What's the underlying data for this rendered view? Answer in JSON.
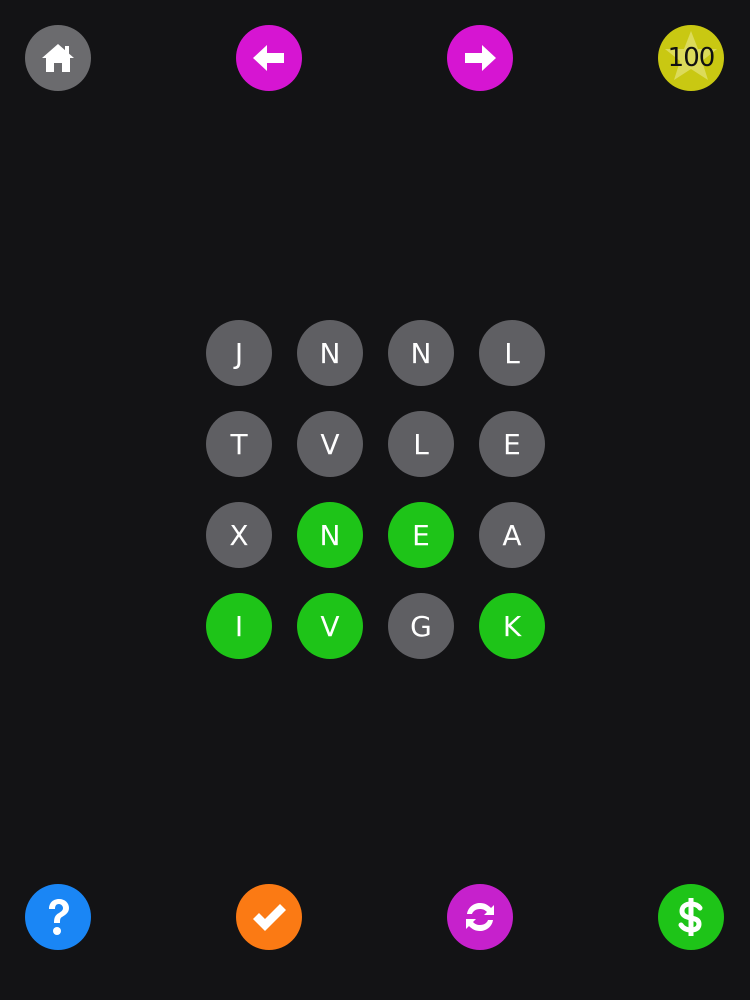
{
  "colors": {
    "background": "#131315",
    "tile_default": "#5f5f63",
    "tile_selected": "#1ec418",
    "home": "#6b6b6e",
    "nav_arrows": "#d615d2",
    "coins": "#c9c812",
    "help": "#1a86f5",
    "check": "#fb7a14",
    "shuffle": "#c621cc",
    "buy": "#1ec418"
  },
  "header": {
    "home_icon": "house-icon",
    "back_icon": "arrow-left-icon",
    "forward_icon": "arrow-right-icon",
    "coins_icon": "star-icon",
    "coins": "100"
  },
  "board": {
    "rows": [
      [
        {
          "letter": "J",
          "selected": false
        },
        {
          "letter": "N",
          "selected": false
        },
        {
          "letter": "N",
          "selected": false
        },
        {
          "letter": "L",
          "selected": false
        }
      ],
      [
        {
          "letter": "T",
          "selected": false
        },
        {
          "letter": "V",
          "selected": false
        },
        {
          "letter": "L",
          "selected": false
        },
        {
          "letter": "E",
          "selected": false
        }
      ],
      [
        {
          "letter": "X",
          "selected": false
        },
        {
          "letter": "N",
          "selected": true
        },
        {
          "letter": "E",
          "selected": true
        },
        {
          "letter": "A",
          "selected": false
        }
      ],
      [
        {
          "letter": "I",
          "selected": true
        },
        {
          "letter": "V",
          "selected": true
        },
        {
          "letter": "G",
          "selected": false
        },
        {
          "letter": "K",
          "selected": true
        }
      ]
    ]
  },
  "footer": {
    "help_icon": "question-mark-icon",
    "check_icon": "checkmark-icon",
    "shuffle_icon": "refresh-icon",
    "buy_icon": "dollar-icon"
  }
}
